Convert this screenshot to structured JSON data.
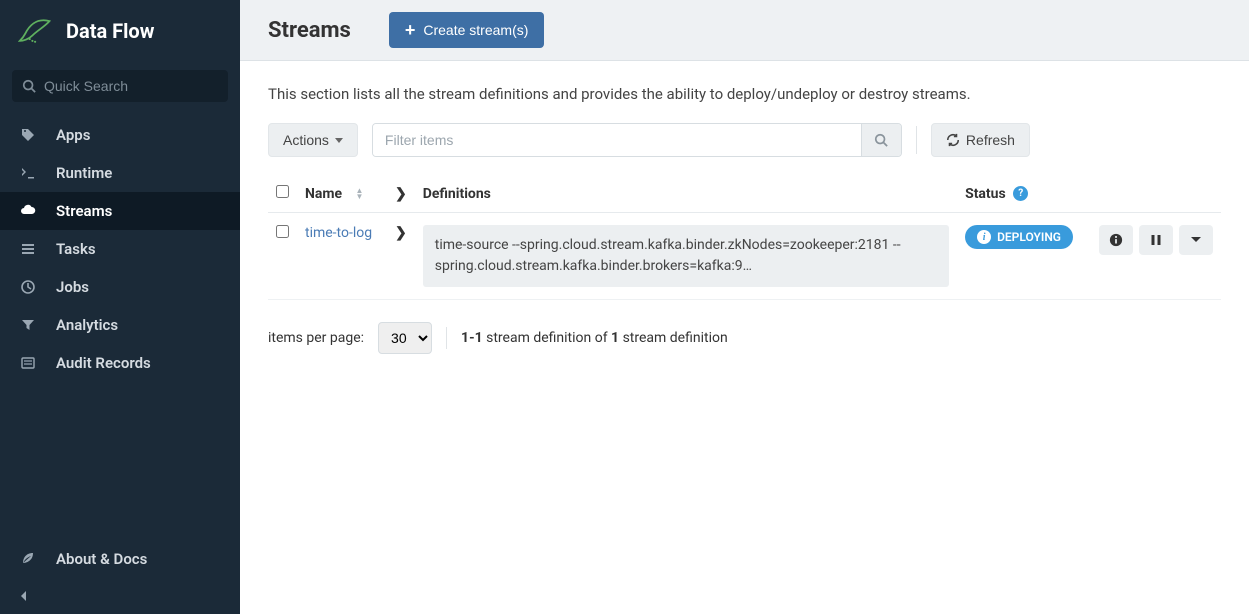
{
  "brand": "Data Flow",
  "search": {
    "placeholder": "Quick Search"
  },
  "sidebar": {
    "items": [
      {
        "label": "Apps"
      },
      {
        "label": "Runtime"
      },
      {
        "label": "Streams"
      },
      {
        "label": "Tasks"
      },
      {
        "label": "Jobs"
      },
      {
        "label": "Analytics"
      },
      {
        "label": "Audit Records"
      }
    ]
  },
  "footer": {
    "about": "About & Docs"
  },
  "header": {
    "title": "Streams",
    "create_label": "Create stream(s)"
  },
  "description": "This section lists all the stream definitions and provides the ability to deploy/undeploy or destroy streams.",
  "toolbar": {
    "actions_label": "Actions",
    "filter_placeholder": "Filter items",
    "refresh_label": "Refresh"
  },
  "table": {
    "col_name": "Name",
    "col_definitions": "Definitions",
    "col_status": "Status"
  },
  "streams": [
    {
      "name": "time-to-log",
      "definition": "time-source --spring.cloud.stream.kafka.binder.zkNodes=zookeeper:2181 --spring.cloud.stream.kafka.binder.brokers=kafka:9…",
      "status": "DEPLOYING"
    }
  ],
  "pager": {
    "label": "items per page:",
    "selected": "30",
    "range": "1-1",
    "mid": " stream definition of ",
    "total": "1",
    "tail": " stream definition"
  }
}
